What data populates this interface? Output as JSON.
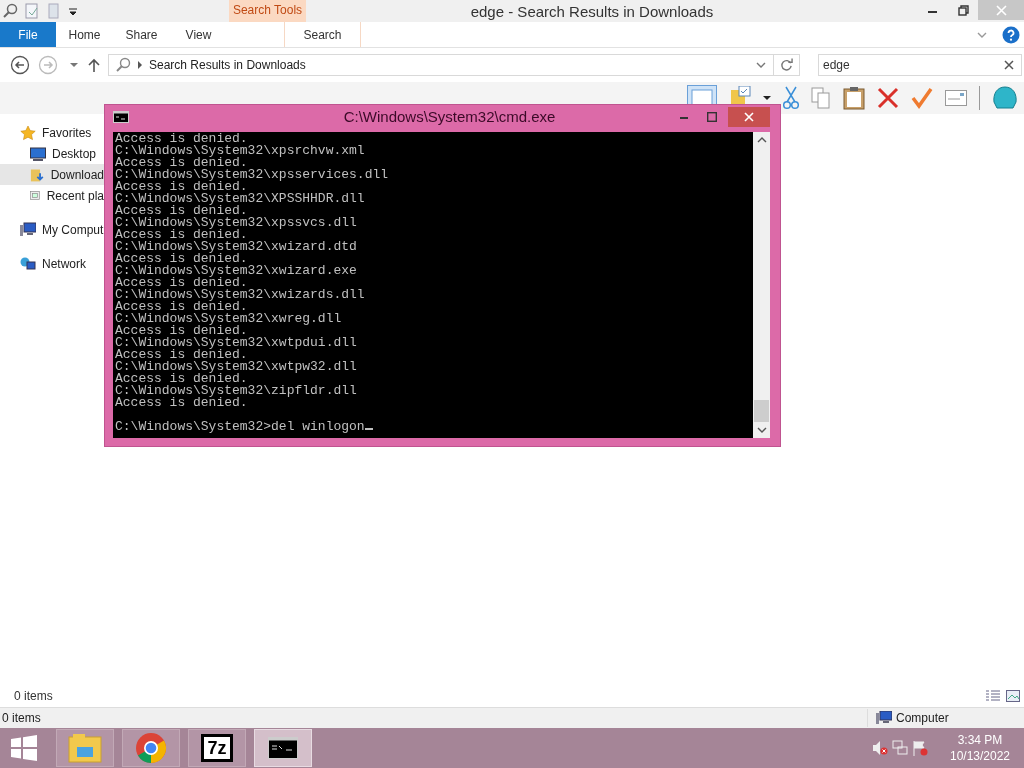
{
  "explorer": {
    "title": "edge - Search Results in Downloads",
    "context_group": "Search Tools",
    "ribbon_tabs": [
      {
        "label": "File",
        "kind": "file"
      },
      {
        "label": "Home",
        "kind": "tab"
      },
      {
        "label": "Share",
        "kind": "tab"
      },
      {
        "label": "View",
        "kind": "tab"
      },
      {
        "label": "Search",
        "kind": "contextual"
      }
    ],
    "address": {
      "breadcrumb": "Search Results in Downloads"
    },
    "search": {
      "value": "edge"
    },
    "sidebar": [
      {
        "label": "Favorites",
        "selected": false,
        "children": [
          {
            "label": "Desktop",
            "selected": false
          },
          {
            "label": "Download",
            "selected": true
          },
          {
            "label": "Recent pla",
            "selected": false
          }
        ]
      },
      {
        "label": "My Comput",
        "selected": false
      },
      {
        "label": "Network",
        "selected": false
      }
    ],
    "item_count": "0 items",
    "status_bar": {
      "items": "0 items",
      "location": "Computer"
    }
  },
  "console": {
    "title": "C:\\Windows\\System32\\cmd.exe",
    "lines": [
      "Access is denied.",
      "C:\\Windows\\System32\\xpsrchvw.xml",
      "Access is denied.",
      "C:\\Windows\\System32\\xpsservices.dll",
      "Access is denied.",
      "C:\\Windows\\System32\\XPSSHHDR.dll",
      "Access is denied.",
      "C:\\Windows\\System32\\xpssvcs.dll",
      "Access is denied.",
      "C:\\Windows\\System32\\xwizard.dtd",
      "Access is denied.",
      "C:\\Windows\\System32\\xwizard.exe",
      "Access is denied.",
      "C:\\Windows\\System32\\xwizards.dll",
      "Access is denied.",
      "C:\\Windows\\System32\\xwreg.dll",
      "Access is denied.",
      "C:\\Windows\\System32\\xwtpdui.dll",
      "Access is denied.",
      "C:\\Windows\\System32\\xwtpw32.dll",
      "Access is denied.",
      "C:\\Windows\\System32\\zipfldr.dll",
      "Access is denied."
    ],
    "prompt": "C:\\Windows\\System32>del winlogon"
  },
  "taskbar": {
    "apps": [
      {
        "kind": "explorer",
        "selected": false
      },
      {
        "kind": "chrome",
        "selected": false
      },
      {
        "kind": "sevenzip",
        "label": "7z",
        "selected": false
      },
      {
        "kind": "cmd",
        "selected": true
      }
    ],
    "clock": {
      "time": "3:34 PM",
      "date": "10/13/2022"
    }
  }
}
